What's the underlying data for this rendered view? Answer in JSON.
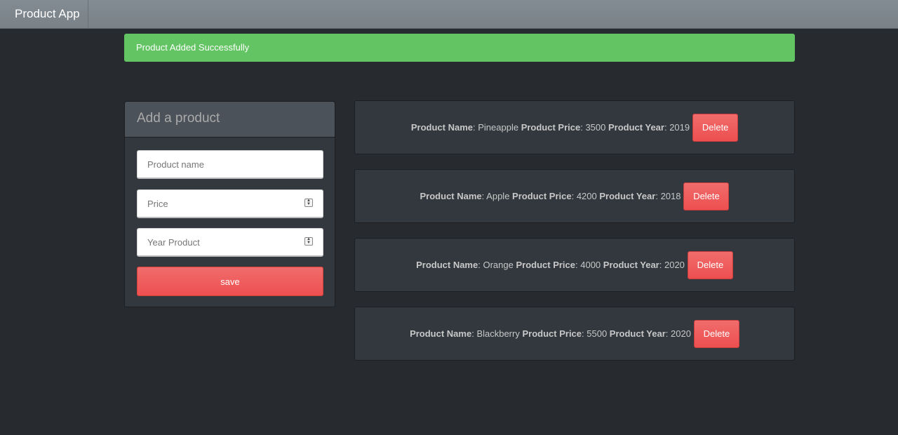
{
  "navbar": {
    "brand": "Product App"
  },
  "alert": {
    "message": "Product Added Successfully"
  },
  "form": {
    "title": "Add a product",
    "name_placeholder": "Product name",
    "price_placeholder": "Price",
    "year_placeholder": "Year Product",
    "save_label": "save"
  },
  "labels": {
    "name": "Product Name",
    "price": "Product Price",
    "year": "Product Year",
    "delete": "Delete"
  },
  "products": [
    {
      "name": "Pineapple",
      "price": "3500",
      "year": "2019"
    },
    {
      "name": "Apple",
      "price": "4200",
      "year": "2018"
    },
    {
      "name": "Orange",
      "price": "4000",
      "year": "2020"
    },
    {
      "name": "Blackberry",
      "price": "5500",
      "year": "2020"
    }
  ],
  "colors": {
    "background": "#272b30",
    "navbar": "#7a8288",
    "alert_success": "#62c462",
    "danger": "#ee5f5b",
    "card": "#32383e"
  }
}
